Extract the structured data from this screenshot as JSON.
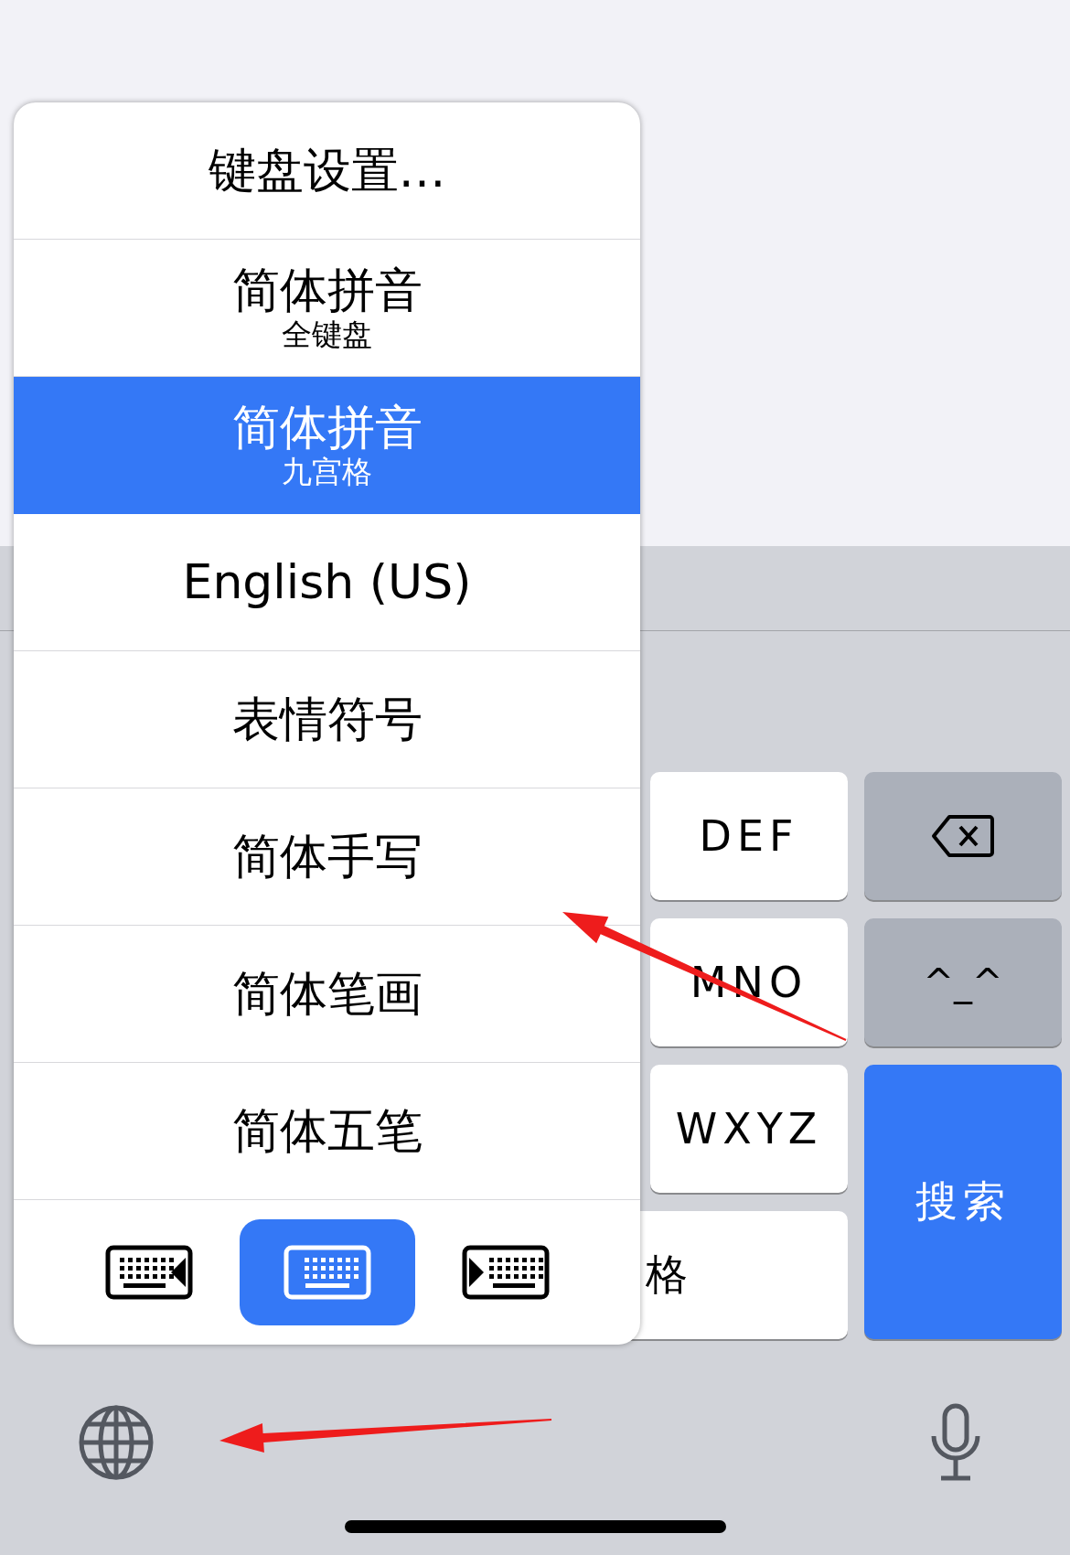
{
  "menu": {
    "items": [
      {
        "label": "键盘设置…",
        "selected": false
      },
      {
        "label": "简体拼音",
        "sublabel": "全键盘",
        "selected": false
      },
      {
        "label": "简体拼音",
        "sublabel": "九宫格",
        "selected": true
      },
      {
        "label": "English (US)",
        "selected": false
      },
      {
        "label": "表情符号",
        "selected": false
      },
      {
        "label": "简体手写",
        "selected": false
      },
      {
        "label": "简体笔画",
        "selected": false
      },
      {
        "label": "简体五笔",
        "selected": false
      }
    ],
    "keyboard_modes": [
      {
        "kind": "left",
        "selected": false
      },
      {
        "kind": "full",
        "selected": true
      },
      {
        "kind": "right",
        "selected": false
      }
    ]
  },
  "keys": [
    {
      "kind": "letter",
      "label": "DEF"
    },
    {
      "kind": "delete"
    },
    {
      "kind": "letter",
      "label": "MNO"
    },
    {
      "kind": "function",
      "label": "^_^"
    },
    {
      "kind": "letter",
      "label": "WXYZ"
    },
    {
      "kind": "action",
      "label": "搜索"
    },
    {
      "kind": "space",
      "label": "格"
    }
  ],
  "annotations": [
    {
      "kind": "arrow"
    },
    {
      "kind": "arrow"
    }
  ]
}
